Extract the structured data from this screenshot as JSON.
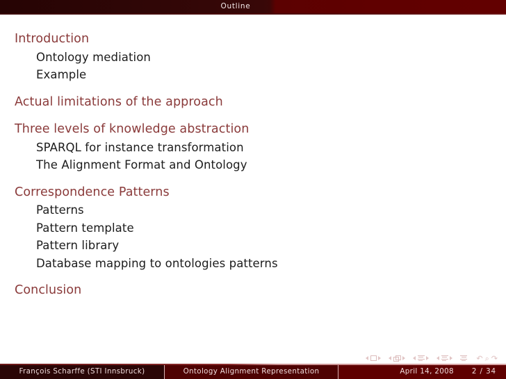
{
  "slide": {
    "header": {
      "title": "Outline"
    },
    "outline": [
      {
        "section": "Introduction",
        "subsections": [
          "Ontology mediation",
          "Example"
        ]
      },
      {
        "section": "Actual limitations of the approach",
        "subsections": []
      },
      {
        "section": "Three levels of knowledge abstraction",
        "subsections": [
          "SPARQL for instance transformation",
          "The Alignment Format and Ontology"
        ]
      },
      {
        "section": "Correspondence Patterns",
        "subsections": [
          "Patterns",
          "Pattern template",
          "Pattern library",
          "Database mapping to ontologies patterns"
        ]
      },
      {
        "section": "Conclusion",
        "subsections": []
      }
    ],
    "navigation_symbols": [
      "prev-slide-icon",
      "slide-icon",
      "next-slide-icon",
      "prev-frame-icon",
      "frame-icon",
      "next-frame-icon",
      "prev-subsection-icon",
      "subsection-icon",
      "next-subsection-icon",
      "prev-section-icon",
      "section-icon",
      "next-section-icon",
      "presentation-icon",
      "back-icon",
      "search-icon",
      "forward-icon"
    ],
    "footer": {
      "author": "François Scharffe  (STI Innsbruck)",
      "title": "Ontology Alignment Representation",
      "date": "April 14, 2008",
      "page": "2 / 34"
    },
    "colors": {
      "header_dark": "#2a0606",
      "header_light": "#600000",
      "section_text": "#8a3a3a",
      "subsection_text": "#1c1c1c",
      "footer_dark": "#2a0606",
      "footer_mid": "#4e0202",
      "footer_light": "#5f0000",
      "footer_text": "#efdcdc",
      "nav_symbol": "#e0c2c2"
    }
  }
}
